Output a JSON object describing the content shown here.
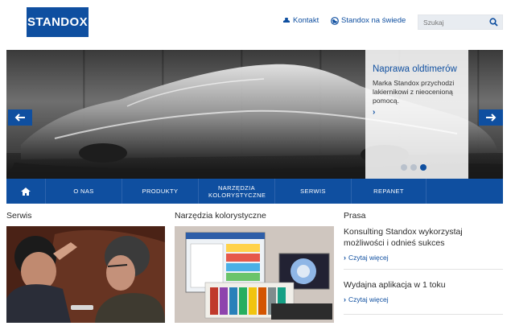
{
  "brand": {
    "logo_text": "STANDOX",
    "color": "#0f4fa0"
  },
  "header": {
    "links": [
      {
        "label": "Kontakt",
        "icon": "person-icon"
      },
      {
        "label": "Standox na świede",
        "icon": "globe-icon"
      }
    ],
    "search_placeholder": "Szukaj"
  },
  "hero": {
    "title": "Naprawa oldtimerów",
    "text": "Marka Standox przychodzi lakiernikowi z nieocenioną pomocą.",
    "more": "›",
    "slides_total": 3,
    "active_slide": 3
  },
  "nav": {
    "items": [
      {
        "label": "",
        "icon": "home-icon"
      },
      {
        "label": "O NAS"
      },
      {
        "label": "PRODUKTY"
      },
      {
        "label": "NARZĘDZIA KOLORYSTYCZNE"
      },
      {
        "label": "SERWIS"
      },
      {
        "label": "REPANET"
      }
    ]
  },
  "columns": [
    {
      "title": "Serwis"
    },
    {
      "title": "Narzędzia kolorystyczne"
    },
    {
      "title": "Prasa"
    }
  ],
  "press": [
    {
      "title": "Konsulting Standox wykorzystaj możliwości i odnieś sukces",
      "link": "Czytaj więcej"
    },
    {
      "title": "Wydajna aplikacja w 1 toku",
      "link": "Czytaj więcej"
    }
  ]
}
